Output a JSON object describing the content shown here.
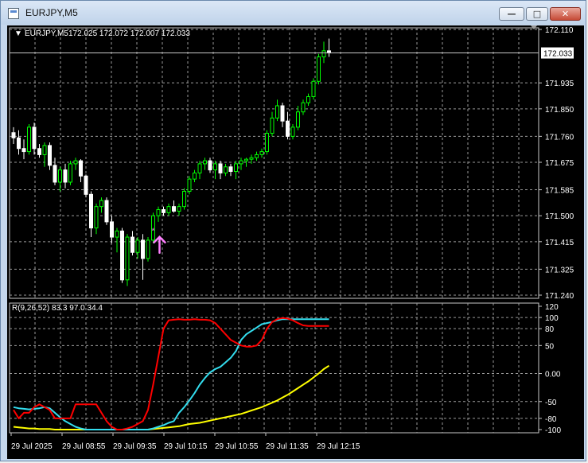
{
  "window": {
    "title": "EURJPY,M5"
  },
  "header": {
    "symbol": "EURJPY,M5",
    "ohlc": "172.025 172.072 172.007 172.033"
  },
  "indicator": {
    "label": "R(9,26,52) 83.3 97.0 34.4",
    "y_ticks": [
      "120",
      "100",
      "80",
      "50",
      "0.00",
      "-50",
      "-80",
      "-100"
    ]
  },
  "colors": {
    "background": "#000000",
    "grid": "#9a9a9a",
    "candle_up": "#00ff00",
    "candle_down": "#ffffff",
    "signal_arrow": "#ff80ff",
    "line_red": "#ff0000",
    "line_cyan": "#33ddee",
    "line_yellow": "#ffff00"
  },
  "chart_data": {
    "type": "candlestick",
    "symbol": "EURJPY",
    "timeframe": "M5",
    "y_ticks": [
      "172.110",
      "171.935",
      "171.850",
      "171.760",
      "171.675",
      "171.585",
      "171.500",
      "171.415",
      "171.325",
      "171.240"
    ],
    "current_price": "172.033",
    "x_ticks": [
      "29 Jul 2025",
      "29 Jul 08:55",
      "29 Jul 09:35",
      "29 Jul 10:15",
      "29 Jul 10:55",
      "29 Jul 11:35",
      "29 Jul 12:15"
    ],
    "ylim": [
      171.24,
      172.11
    ],
    "candles": [
      [
        171.772,
        171.79,
        171.735,
        171.755
      ],
      [
        171.755,
        171.78,
        171.7,
        171.72
      ],
      [
        171.72,
        171.75,
        171.685,
        171.71
      ],
      [
        171.71,
        171.8,
        171.7,
        171.79
      ],
      [
        171.79,
        171.805,
        171.7,
        171.72
      ],
      [
        171.72,
        171.735,
        171.69,
        171.7
      ],
      [
        171.7,
        171.74,
        171.66,
        171.73
      ],
      [
        171.73,
        171.74,
        171.65,
        171.665
      ],
      [
        171.665,
        171.69,
        171.6,
        171.61
      ],
      [
        171.61,
        171.66,
        171.58,
        171.65
      ],
      [
        171.65,
        171.67,
        171.59,
        171.61
      ],
      [
        171.61,
        171.68,
        171.6,
        171.67
      ],
      [
        171.67,
        171.69,
        171.65,
        171.68
      ],
      [
        171.68,
        171.685,
        171.61,
        171.63
      ],
      [
        171.63,
        171.635,
        171.56,
        171.57
      ],
      [
        171.57,
        171.58,
        171.43,
        171.46
      ],
      [
        171.46,
        171.54,
        171.44,
        171.53
      ],
      [
        171.53,
        171.56,
        171.51,
        171.55
      ],
      [
        171.55,
        171.56,
        171.47,
        171.48
      ],
      [
        171.48,
        171.5,
        171.41,
        171.43
      ],
      [
        171.43,
        171.46,
        171.38,
        171.45
      ],
      [
        171.45,
        171.46,
        171.28,
        171.29
      ],
      [
        171.29,
        171.44,
        171.27,
        171.43
      ],
      [
        171.43,
        171.45,
        171.37,
        171.38
      ],
      [
        171.38,
        171.43,
        171.36,
        171.42
      ],
      [
        171.42,
        171.44,
        171.29,
        171.36
      ],
      [
        171.36,
        171.43,
        171.35,
        171.42
      ],
      [
        171.42,
        171.51,
        171.41,
        171.5
      ],
      [
        171.5,
        171.53,
        171.48,
        171.52
      ],
      [
        171.52,
        171.53,
        171.5,
        171.51
      ],
      [
        171.51,
        171.54,
        171.5,
        171.53
      ],
      [
        171.53,
        171.55,
        171.51,
        171.515
      ],
      [
        171.515,
        171.54,
        171.5,
        171.53
      ],
      [
        171.53,
        171.59,
        171.52,
        171.58
      ],
      [
        171.58,
        171.63,
        171.57,
        171.62
      ],
      [
        171.62,
        171.65,
        171.61,
        171.64
      ],
      [
        171.64,
        171.68,
        171.62,
        171.67
      ],
      [
        171.67,
        171.69,
        171.65,
        171.68
      ],
      [
        171.68,
        171.69,
        171.64,
        171.65
      ],
      [
        171.65,
        171.68,
        171.62,
        171.67
      ],
      [
        171.67,
        171.68,
        171.62,
        171.64
      ],
      [
        171.64,
        171.67,
        171.63,
        171.66
      ],
      [
        171.66,
        171.67,
        171.63,
        171.645
      ],
      [
        171.645,
        171.68,
        171.62,
        171.67
      ],
      [
        171.67,
        171.69,
        171.65,
        171.68
      ],
      [
        171.68,
        171.69,
        171.66,
        171.685
      ],
      [
        171.685,
        171.7,
        171.67,
        171.69
      ],
      [
        171.69,
        171.71,
        171.68,
        171.7
      ],
      [
        171.7,
        171.72,
        171.69,
        171.71
      ],
      [
        171.71,
        171.78,
        171.7,
        171.77
      ],
      [
        171.77,
        171.84,
        171.76,
        171.82
      ],
      [
        171.82,
        171.88,
        171.81,
        171.86
      ],
      [
        171.86,
        171.87,
        171.79,
        171.81
      ],
      [
        171.81,
        171.84,
        171.75,
        171.76
      ],
      [
        171.76,
        171.8,
        171.75,
        171.79
      ],
      [
        171.79,
        171.86,
        171.78,
        171.84
      ],
      [
        171.84,
        171.88,
        171.83,
        171.87
      ],
      [
        171.87,
        171.9,
        171.86,
        171.89
      ],
      [
        171.89,
        171.95,
        171.88,
        171.94
      ],
      [
        171.94,
        172.03,
        171.93,
        172.02
      ],
      [
        172.02,
        172.07,
        172.0,
        172.04
      ],
      [
        172.04,
        172.08,
        172.02,
        172.033
      ]
    ],
    "signal_bar_index": 27,
    "oscillator": {
      "ylim": [
        -100,
        120
      ],
      "red": [
        -65,
        -80,
        -70,
        -70,
        -60,
        -55,
        -60,
        -65,
        -80,
        -80,
        -80,
        -80,
        -55,
        -55,
        -55,
        -55,
        -55,
        -70,
        -85,
        -95,
        -100,
        -100,
        -98,
        -95,
        -90,
        -85,
        -65,
        -20,
        30,
        80,
        95,
        96,
        97,
        96,
        96,
        97,
        96,
        96,
        95,
        90,
        80,
        70,
        60,
        55,
        50,
        48,
        48,
        50,
        60,
        80,
        92,
        97,
        99,
        98,
        95,
        90,
        86,
        85,
        85,
        85,
        85,
        85
      ],
      "cyan": [
        -60,
        -62,
        -63,
        -64,
        -63,
        -62,
        -60,
        -62,
        -70,
        -78,
        -85,
        -90,
        -95,
        -98,
        -100,
        -100,
        -100,
        -100,
        -100,
        -100,
        -100,
        -100,
        -100,
        -100,
        -100,
        -100,
        -100,
        -98,
        -95,
        -92,
        -88,
        -85,
        -70,
        -60,
        -48,
        -35,
        -20,
        -8,
        2,
        8,
        12,
        20,
        28,
        40,
        60,
        70,
        76,
        82,
        88,
        90,
        92,
        95,
        97,
        97,
        97,
        97,
        97,
        97,
        97,
        97,
        97,
        97
      ],
      "yellow": [
        -95,
        -96,
        -97,
        -98,
        -98,
        -99,
        -99,
        -99,
        -100,
        -100,
        -100,
        -100,
        -100,
        -100,
        -100,
        -100,
        -100,
        -100,
        -100,
        -100,
        -100,
        -100,
        -100,
        -100,
        -100,
        -100,
        -100,
        -99,
        -98,
        -97,
        -96,
        -95,
        -94,
        -92,
        -90,
        -89,
        -88,
        -86,
        -84,
        -82,
        -80,
        -78,
        -76,
        -74,
        -72,
        -69,
        -66,
        -63,
        -60,
        -56,
        -52,
        -48,
        -43,
        -38,
        -32,
        -26,
        -20,
        -14,
        -7,
        0,
        8,
        14
      ]
    }
  }
}
